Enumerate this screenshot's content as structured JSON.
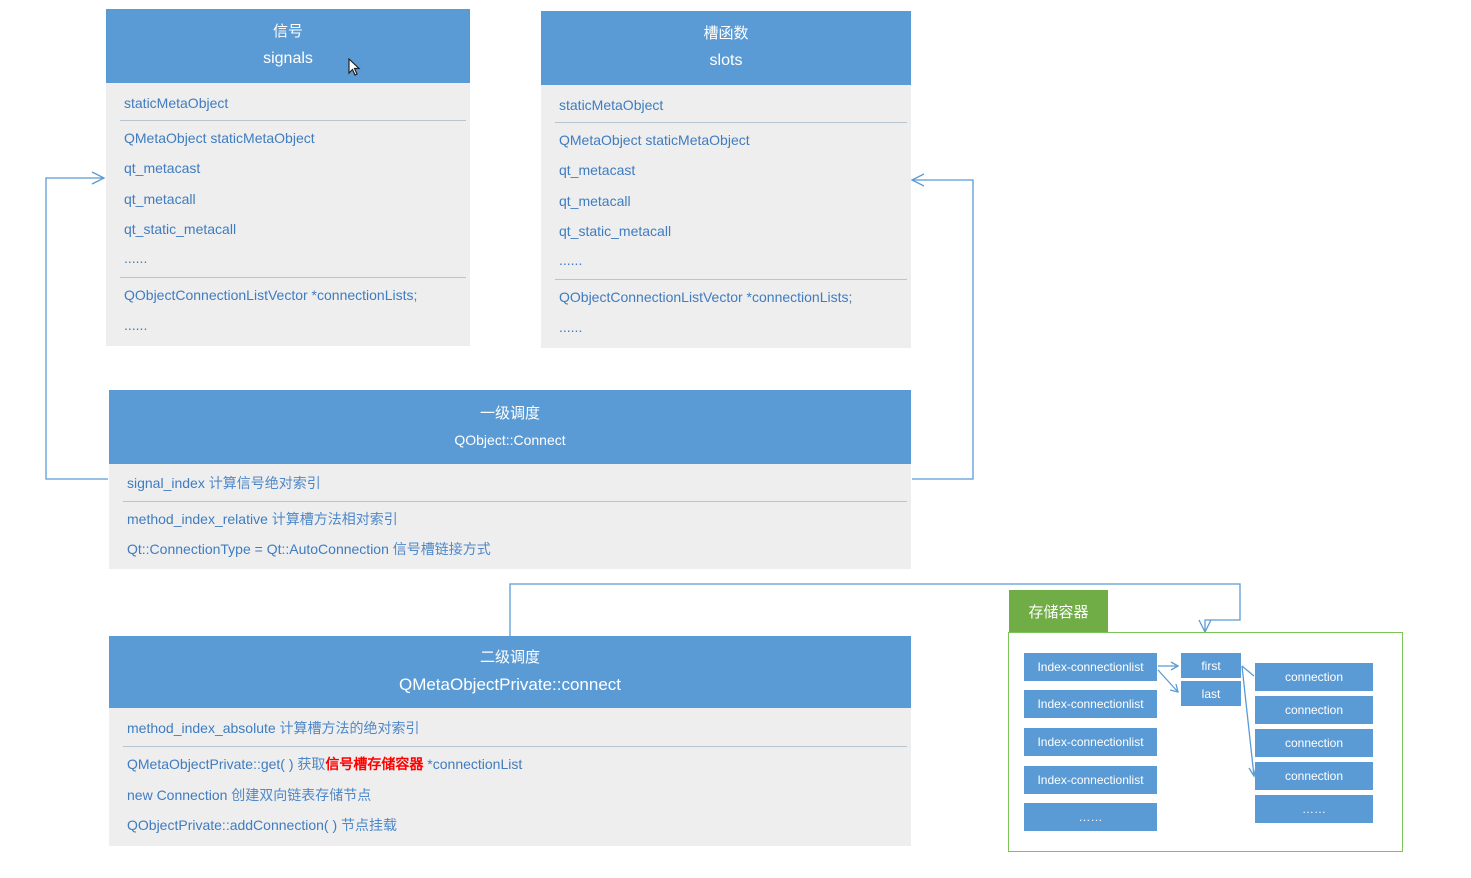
{
  "signals": {
    "title_cn": "信号",
    "title_en": "signals",
    "rows": [
      "staticMetaObject",
      "QMetaObject staticMetaObject",
      "qt_metacast",
      "qt_metacall",
      "qt_static_metacall",
      "......",
      "QObjectConnectionListVector *connectionLists;",
      "......"
    ]
  },
  "slots": {
    "title_cn": "槽函数",
    "title_en": "slots",
    "rows": [
      "staticMetaObject",
      "QMetaObject staticMetaObject",
      "qt_metacast",
      "qt_metacall",
      "qt_static_metacall",
      "......",
      "QObjectConnectionListVector *connectionLists;",
      "......"
    ]
  },
  "level1": {
    "title_cn": "一级调度",
    "title_en": "QObject::Connect",
    "rows": [
      {
        "code": "signal_index",
        "cn": " 计算信号绝对索引"
      },
      {
        "code": "method_index_relative",
        "cn": " 计算槽方法相对索引"
      },
      {
        "code": "Qt::ConnectionType = Qt::AutoConnection",
        "cn": " 信号槽链接方式"
      }
    ]
  },
  "level2": {
    "title_cn": "二级调度",
    "title_en": "QMetaObjectPrivate::connect",
    "rows": [
      {
        "code": "method_index_absolute",
        "cn": " 计算槽方法的绝对索引"
      },
      {
        "code": "QMetaObjectPrivate::get( ) ",
        "cn": "获取",
        "red": "信号槽存储容器",
        "tail": " *connectionList"
      },
      {
        "code": "new Connection",
        "cn": " 创建双向链表存储节点"
      },
      {
        "code": "QObjectPrivate::addConnection( )",
        "cn": " 节点挂载"
      }
    ]
  },
  "storage": {
    "label": "存储容器",
    "index_items": [
      "Index-connectionlist",
      "Index-connectionlist",
      "Index-connectionlist",
      "Index-connectionlist",
      "……"
    ],
    "pointer_items": [
      "first",
      "last"
    ],
    "connection_items": [
      "connection",
      "connection",
      "connection",
      "connection",
      "……"
    ]
  },
  "colors": {
    "header_blue": "#5b9bd5",
    "body_gray": "#eeeeee",
    "text_blue": "#3f7cc0",
    "container_green": "#70ad47",
    "highlight_red": "#ff0000"
  }
}
